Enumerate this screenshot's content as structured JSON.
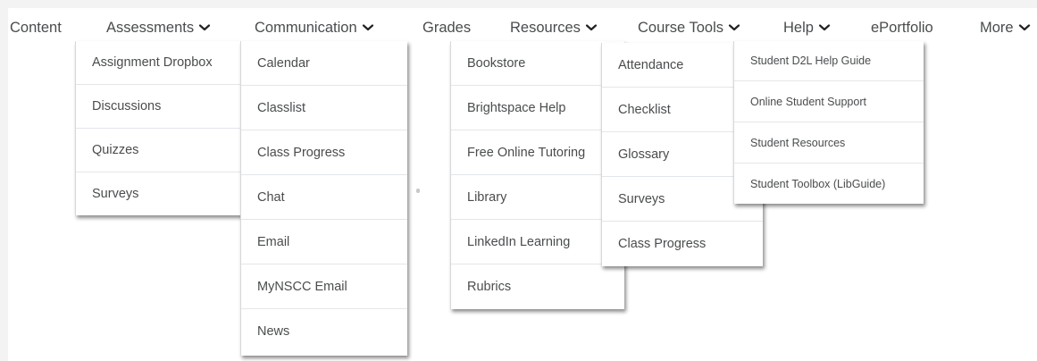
{
  "navbar": {
    "items": [
      {
        "label": "Content",
        "has_dropdown": false
      },
      {
        "label": "Assessments",
        "has_dropdown": true
      },
      {
        "label": "Communication",
        "has_dropdown": true
      },
      {
        "label": "Grades",
        "has_dropdown": false
      },
      {
        "label": "Resources",
        "has_dropdown": true
      },
      {
        "label": "Course Tools",
        "has_dropdown": true
      },
      {
        "label": "Help",
        "has_dropdown": true
      },
      {
        "label": "ePortfolio",
        "has_dropdown": false
      },
      {
        "label": "More",
        "has_dropdown": true
      }
    ]
  },
  "menus": {
    "assessments": [
      "Assignment Dropbox",
      "Discussions",
      "Quizzes",
      "Surveys"
    ],
    "communication": [
      "Calendar",
      "Classlist",
      "Class Progress",
      "Chat",
      "Email",
      "MyNSCC Email",
      "News"
    ],
    "resources": [
      "Bookstore",
      "Brightspace Help",
      "Free Online Tutoring",
      "Library",
      "LinkedIn Learning",
      "Rubrics"
    ],
    "course_tools": [
      "Attendance",
      "Checklist",
      "Glossary",
      "Surveys",
      "Class Progress"
    ],
    "help": [
      "Student D2L Help Guide",
      "Online Student Support",
      "Student Resources",
      "Student Toolbox (LibGuide)"
    ]
  },
  "colors": {
    "text": "#494c4e",
    "separator": "#e3e6ea",
    "frame": "#f3f3f4"
  },
  "icons": {
    "dropdown": "chevron-down-icon"
  }
}
